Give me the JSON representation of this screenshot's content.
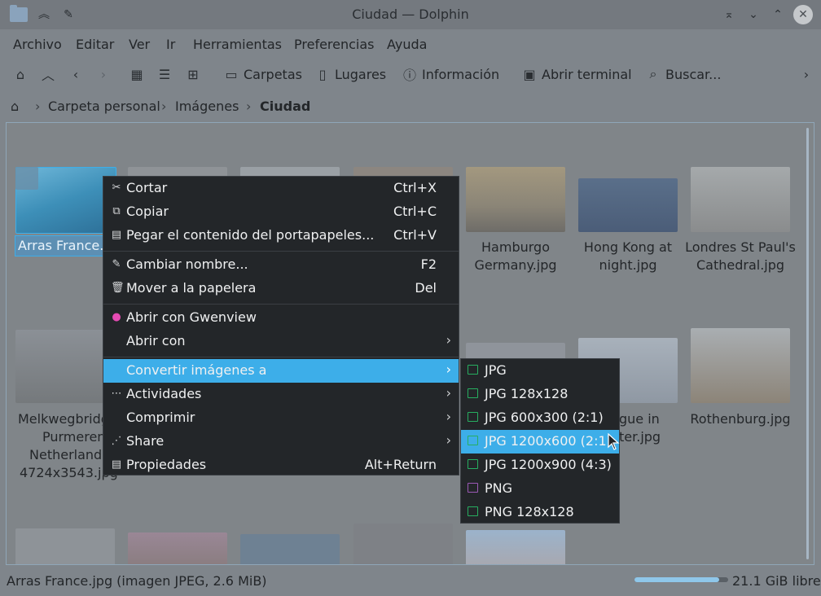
{
  "window": {
    "title": "Ciudad — Dolphin"
  },
  "menubar": [
    "Archivo",
    "Editar",
    "Ver",
    "Ir",
    "Herramientas",
    "Preferencias",
    "Ayuda"
  ],
  "toolbar": {
    "folders": "Carpetas",
    "places": "Lugares",
    "info": "Información",
    "terminal": "Abrir terminal",
    "search": "Buscar..."
  },
  "breadcrumb": {
    "home": "Carpeta personal",
    "pictures": "Imágenes",
    "current": "Ciudad"
  },
  "files": {
    "selected": "Arras France.jpg",
    "hamburgo": [
      "Hamburgo",
      "Germany.jpg"
    ],
    "hongkong": [
      "Hong Kong at",
      "night.jpg"
    ],
    "londres": [
      "Londres St Paul's",
      "Cathedral.jpg"
    ],
    "melk": [
      "Melkwegbridg",
      "Purmerend",
      "Netherlands",
      "4724x3543.jpg"
    ],
    "prague": [
      "gue in",
      "ter.jpg"
    ],
    "rothenburg": "Rothenburg.jpg"
  },
  "context_menu": {
    "cut": {
      "label": "Cortar",
      "shortcut": "Ctrl+X"
    },
    "copy": {
      "label": "Copiar",
      "shortcut": "Ctrl+C"
    },
    "paste": {
      "label": "Pegar el contenido del portapapeles...",
      "shortcut": "Ctrl+V"
    },
    "rename": {
      "label": "Cambiar nombre...",
      "shortcut": "F2"
    },
    "trash": {
      "label": "Mover a la papelera",
      "shortcut": "Del"
    },
    "gwenview": {
      "label": "Abrir con Gwenview"
    },
    "open_with": {
      "label": "Abrir con"
    },
    "convert": {
      "label": "Convertir imágenes a"
    },
    "activities": {
      "label": "Actividades"
    },
    "compress": {
      "label": "Comprimir"
    },
    "share": {
      "label": "Share"
    },
    "properties": {
      "label": "Propiedades",
      "shortcut": "Alt+Return"
    }
  },
  "convert_submenu": [
    "JPG",
    "JPG 128x128",
    "JPG 600x300 (2:1)",
    "JPG 1200x600 (2:1)",
    "JPG 1200x900 (4:3)",
    "PNG",
    "PNG 128x128"
  ],
  "status": {
    "text": "Arras France.jpg (imagen JPEG, 2.6 MiB)",
    "free": "21.1 GiB libre",
    "used_fraction": 0.9
  }
}
